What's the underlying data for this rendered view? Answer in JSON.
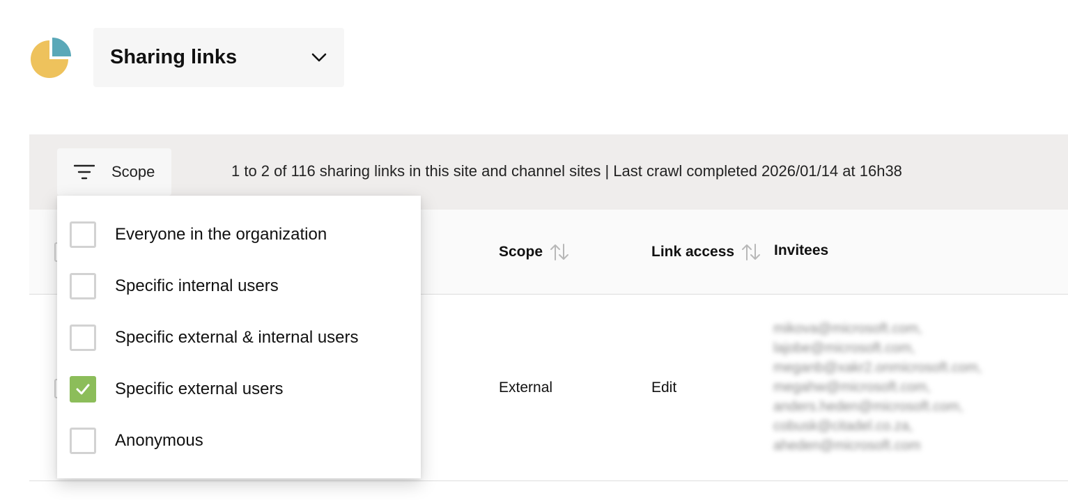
{
  "header": {
    "view_title": "Sharing links",
    "logo_icon": "pie-chart-icon",
    "dropdown_icon": "chevron-down-icon"
  },
  "toolbar": {
    "scope_label": "Scope",
    "scope_icon": "filter-icon",
    "count_text": "1 to 2 of 116 sharing links in this site and channel sites | Last crawl completed 2026/01/14 at 16h38"
  },
  "table": {
    "columns": [
      {
        "label": "Scope",
        "sortable": true
      },
      {
        "label": "Link access",
        "sortable": true
      },
      {
        "label": "Invitees",
        "sortable": false
      }
    ],
    "rows": [
      {
        "scope": "External",
        "link_access": "Edit",
        "invitees": [
          "mikova@microsoft.com,",
          "lajobe@microsoft.com,",
          "meganb@xakr2.onmicrosoft.com,",
          "megahw@microsoft.com,",
          "anders.heden@microsoft.com,",
          "cobusk@citadel.co.za,",
          "aheden@microsoft.com"
        ]
      }
    ]
  },
  "scope_filter": {
    "options": [
      {
        "label": "Everyone in the organization",
        "checked": false
      },
      {
        "label": "Specific internal users",
        "checked": false
      },
      {
        "label": "Specific external & internal users",
        "checked": false
      },
      {
        "label": "Specific external users",
        "checked": true
      },
      {
        "label": "Anonymous",
        "checked": false
      }
    ]
  },
  "colors": {
    "accent_green": "#8cbd5a",
    "logo_yellow": "#eec25c",
    "logo_teal": "#5aa8b8",
    "toolbar_bg": "#efedec"
  }
}
